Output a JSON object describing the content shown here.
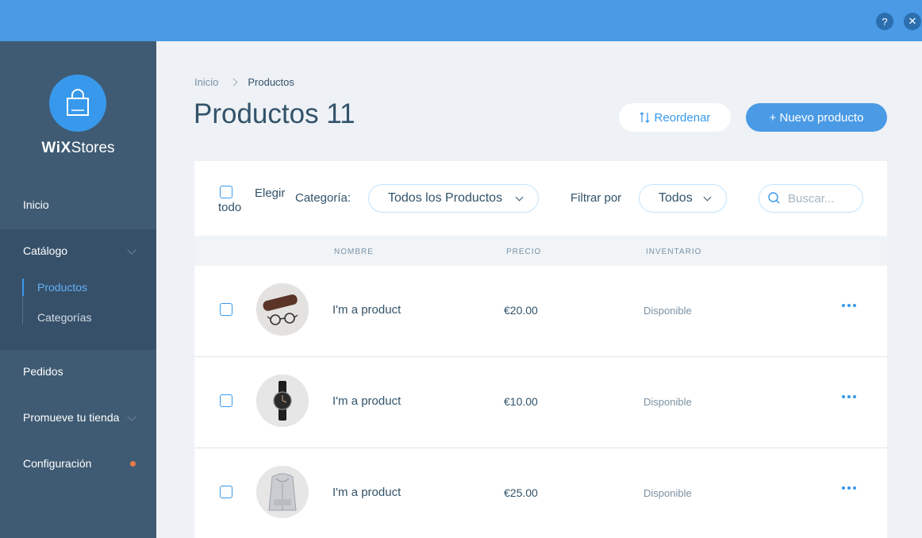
{
  "topbar": {
    "help_label": "?",
    "close_label": "✕"
  },
  "brand": {
    "wix": "WiX",
    "stores": "Stores"
  },
  "sidebar": {
    "items": [
      {
        "label": "Inicio"
      },
      {
        "label": "Catálogo"
      },
      {
        "label": "Pedidos"
      },
      {
        "label": "Promueve tu tienda"
      },
      {
        "label": "Configuración"
      }
    ],
    "catalog_sub": [
      {
        "label": "Productos",
        "active": true
      },
      {
        "label": "Categorías",
        "active": false
      }
    ]
  },
  "breadcrumb": {
    "home": "Inicio",
    "current": "Productos"
  },
  "page": {
    "title": "Productos 11"
  },
  "actions": {
    "reorder_label": "Reordenar",
    "new_label": "+ Nuevo producto"
  },
  "filters": {
    "select_all_line1": "Elegir",
    "select_all_line2": "todo",
    "category_label": "Categoría:",
    "category_value": "Todos los Productos",
    "filter_label": "Filtrar por",
    "filter_value": "Todos",
    "search_placeholder": "Buscar..."
  },
  "table": {
    "headers": {
      "name": "NOMBRE",
      "price": "PRECIO",
      "inventory": "INVENTARIO"
    },
    "rows": [
      {
        "name": "I'm a product",
        "price": "€20.00",
        "inventory": "Disponible",
        "image": "sunglasses-case"
      },
      {
        "name": "I'm a product",
        "price": "€10.00",
        "inventory": "Disponible",
        "image": "wristwatch"
      },
      {
        "name": "I'm a product",
        "price": "€25.00",
        "inventory": "Disponible",
        "image": "hoodie"
      }
    ]
  },
  "colors": {
    "accent": "#3899ec",
    "topbar": "#4a9ae6",
    "sidebar": "#3f5b73",
    "notification_dot": "#e87b4c"
  }
}
